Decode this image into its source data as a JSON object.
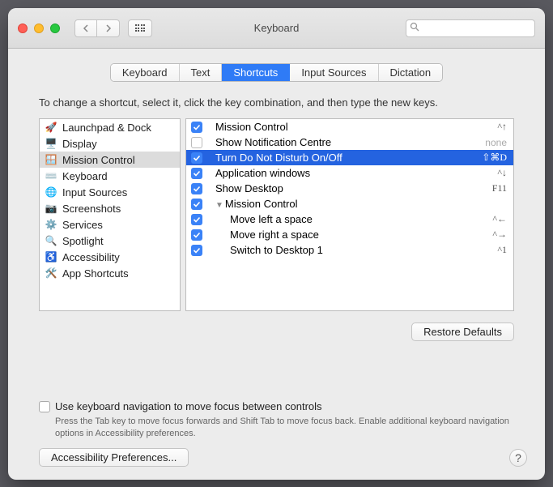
{
  "window": {
    "title": "Keyboard"
  },
  "search": {
    "placeholder": ""
  },
  "tabs": [
    "Keyboard",
    "Text",
    "Shortcuts",
    "Input Sources",
    "Dictation"
  ],
  "active_tab": 2,
  "instruction": "To change a shortcut, select it, click the key combination, and then type the new keys.",
  "sidebar": {
    "items": [
      {
        "label": "Launchpad & Dock",
        "icon": "🚀"
      },
      {
        "label": "Display",
        "icon": "🖥️"
      },
      {
        "label": "Mission Control",
        "icon": "🪟",
        "selected": true
      },
      {
        "label": "Keyboard",
        "icon": "⌨️"
      },
      {
        "label": "Input Sources",
        "icon": "🌐"
      },
      {
        "label": "Screenshots",
        "icon": "📷"
      },
      {
        "label": "Services",
        "icon": "⚙️"
      },
      {
        "label": "Spotlight",
        "icon": "🔍"
      },
      {
        "label": "Accessibility",
        "icon": "♿"
      },
      {
        "label": "App Shortcuts",
        "icon": "🛠️"
      }
    ]
  },
  "shortcuts": [
    {
      "checked": true,
      "label": "Mission Control",
      "keys": "^↑",
      "indent": 0
    },
    {
      "checked": false,
      "label": "Show Notification Centre",
      "keys": "none",
      "none": true,
      "indent": 0
    },
    {
      "checked": true,
      "label": "Turn Do Not Disturb On/Off",
      "keys": "⇧⌘D",
      "indent": 0,
      "selected": true
    },
    {
      "checked": true,
      "label": "Application windows",
      "keys": "^↓",
      "indent": 0
    },
    {
      "checked": true,
      "label": "Show Desktop",
      "keys": "F11",
      "indent": 0
    },
    {
      "checked": true,
      "label": "Mission Control",
      "keys": "",
      "indent": 0,
      "disclose": true
    },
    {
      "checked": true,
      "label": "Move left a space",
      "keys": "^←",
      "indent": 1
    },
    {
      "checked": true,
      "label": "Move right a space",
      "keys": "^→",
      "indent": 1
    },
    {
      "checked": true,
      "label": "Switch to Desktop 1",
      "keys": "^1",
      "indent": 1
    }
  ],
  "restore_label": "Restore Defaults",
  "kbnav_label": "Use keyboard navigation to move focus between controls",
  "kbnav_help": "Press the Tab key to move focus forwards and Shift Tab to move focus back. Enable additional keyboard navigation options in Accessibility preferences.",
  "accpref_label": "Accessibility Preferences..."
}
